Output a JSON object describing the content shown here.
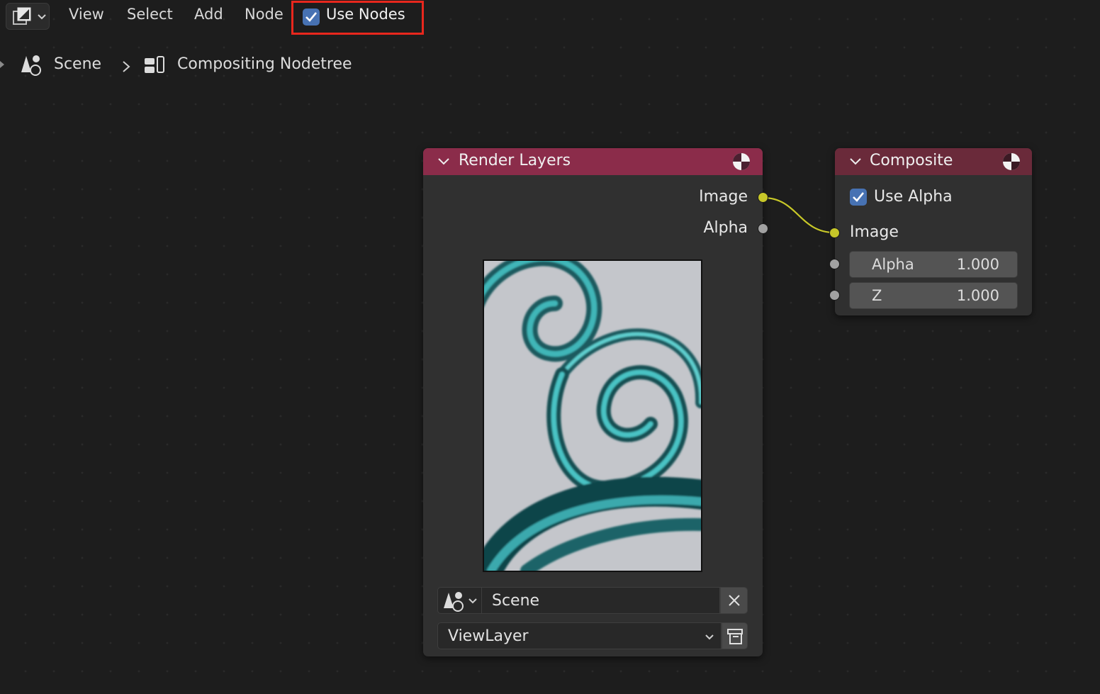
{
  "header": {
    "menu": [
      "View",
      "Select",
      "Add",
      "Node"
    ],
    "use_nodes_label": "Use Nodes",
    "use_nodes_checked": true
  },
  "breadcrumb": {
    "scene": "Scene",
    "nodetree": "Compositing Nodetree"
  },
  "render_layers": {
    "title": "Render Layers",
    "header_color": "#8b2c4a",
    "outputs": [
      "Image",
      "Alpha"
    ],
    "scene_value": "Scene",
    "layer_value": "ViewLayer"
  },
  "composite": {
    "title": "Composite",
    "header_color": "#6a2a3a",
    "use_alpha_label": "Use Alpha",
    "use_alpha_checked": true,
    "input_image": "Image",
    "alpha_label": "Alpha",
    "alpha_value": "1.000",
    "z_label": "Z",
    "z_value": "1.000"
  },
  "colors": {
    "highlight": "#e8271d",
    "checkbox": "#4772b3",
    "link": "#c7c729"
  }
}
